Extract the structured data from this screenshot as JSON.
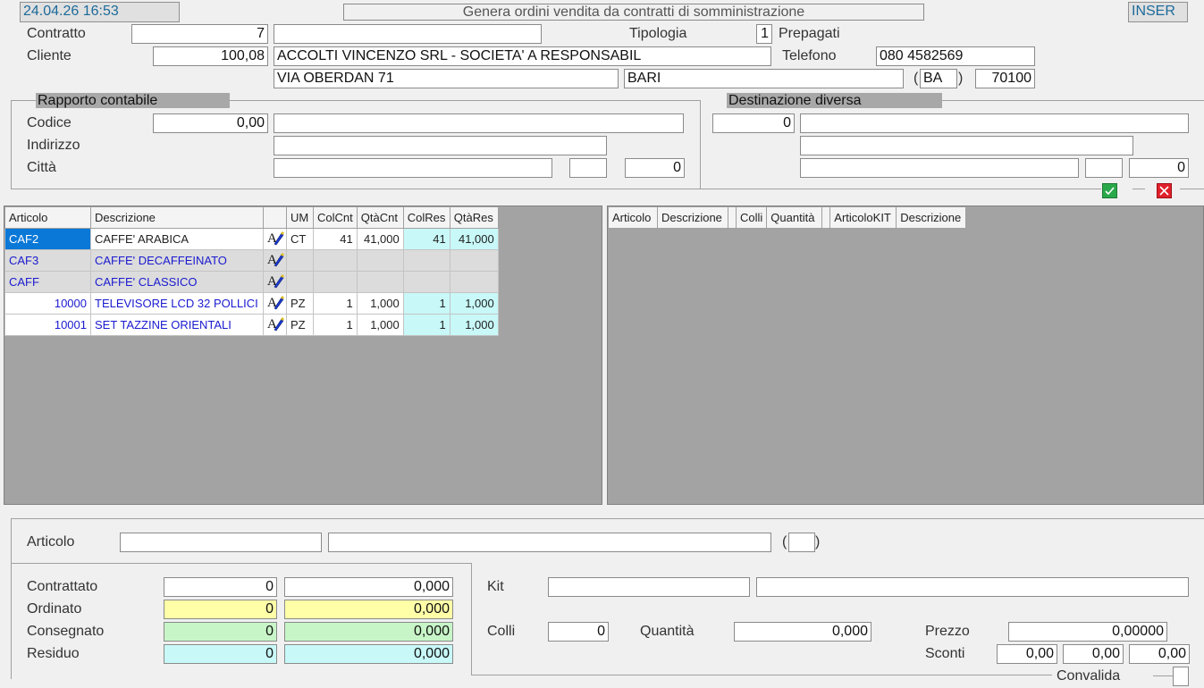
{
  "header": {
    "datetime": "24.04.26 16:53",
    "title": "Genera ordini vendita da contratti di somministrazione",
    "mode": "INSER"
  },
  "contract": {
    "contratto_label": "Contratto",
    "contratto_value": "7",
    "contratto_desc": "",
    "tipologia_label": "Tipologia",
    "tipologia_value": "1",
    "tipologia_desc": "Prepagati",
    "cliente_label": "Cliente",
    "cliente_value": "100,08",
    "cliente_name": "ACCOLTI VINCENZO SRL - SOCIETA' A RESPONSABIL",
    "telefono_label": "Telefono",
    "telefono_value": "080  4582569",
    "address": "VIA OBERDAN 71",
    "city": "BARI",
    "province_open": "(",
    "province": "BA",
    "province_close": ")",
    "cap": "70100"
  },
  "rapporto": {
    "title": "Rapporto contabile",
    "codice_label": "Codice",
    "codice_value": "0,00",
    "codice_desc": "",
    "indirizzo_label": "Indirizzo",
    "indirizzo_value": "",
    "citta_label": "Città",
    "citta_value": "",
    "citta_prov": "",
    "citta_cap": "0"
  },
  "destinazione": {
    "title": "Destinazione diversa",
    "code": "0",
    "desc": "",
    "address": "",
    "city": "",
    "prov": "",
    "cap": "0"
  },
  "left_grid": {
    "columns": [
      "Articolo",
      "Descrizione",
      "",
      "UM",
      "ColCnt",
      "QtàCnt",
      "ColRes",
      "QtàRes"
    ],
    "rows": [
      {
        "articolo": "CAF2",
        "descrizione": "CAFFE' ARABICA",
        "um": "CT",
        "colcnt": "41",
        "qtacnt": "41,000",
        "colres": "41",
        "qtares": "41,000"
      },
      {
        "articolo": "CAF3",
        "descrizione": "CAFFE' DECAFFEINATO",
        "um": "",
        "colcnt": "",
        "qtacnt": "",
        "colres": "",
        "qtares": ""
      },
      {
        "articolo": "CAFF",
        "descrizione": "CAFFE' CLASSICO",
        "um": "",
        "colcnt": "",
        "qtacnt": "",
        "colres": "",
        "qtares": ""
      },
      {
        "articolo": "10000",
        "descrizione": "TELEVISORE  LCD 32 POLLICI",
        "um": "PZ",
        "colcnt": "1",
        "qtacnt": "1,000",
        "colres": "1",
        "qtares": "1,000"
      },
      {
        "articolo": "10001",
        "descrizione": "SET TAZZINE ORIENTALI",
        "um": "PZ",
        "colcnt": "1",
        "qtacnt": "1,000",
        "colres": "1",
        "qtares": "1,000"
      }
    ]
  },
  "right_grid": {
    "columns": [
      "Articolo",
      "Descrizione",
      "",
      "Colli",
      "Quantità",
      "",
      "ArticoloKIT",
      "Descrizione"
    ]
  },
  "detail": {
    "articolo_label": "Articolo",
    "articolo_code": "",
    "articolo_desc": "",
    "paren_open": "(",
    "paren_close": ")",
    "articolo_um": "",
    "contrattato_label": "Contrattato",
    "contrattato_col": "0",
    "contrattato_qta": "0,000",
    "ordinato_label": "Ordinato",
    "ordinato_col": "0",
    "ordinato_qta": "0,000",
    "consegnato_label": "Consegnato",
    "consegnato_col": "0",
    "consegnato_qta": "0,000",
    "residuo_label": "Residuo",
    "residuo_col": "0",
    "residuo_qta": "0,000",
    "kit_label": "Kit",
    "kit_code": "",
    "kit_desc": "",
    "colli_label": "Colli",
    "colli_value": "0",
    "quantita_label": "Quantità",
    "quantita_value": "0,000",
    "prezzo_label": "Prezzo",
    "prezzo_value": "0,00000",
    "sconti_label": "Sconti",
    "sconto1": "0,00",
    "sconto2": "0,00",
    "sconto3": "0,00",
    "convalida_label": "Convalida"
  },
  "colors": {
    "selected": "#0a78d7",
    "accent_text": "#1a1ad0",
    "residual": "#c8f8f8",
    "ordered": "#ffffa8",
    "delivered": "#c8f5c8",
    "confirm": "#2aa84a",
    "cancel": "#e0202a"
  }
}
